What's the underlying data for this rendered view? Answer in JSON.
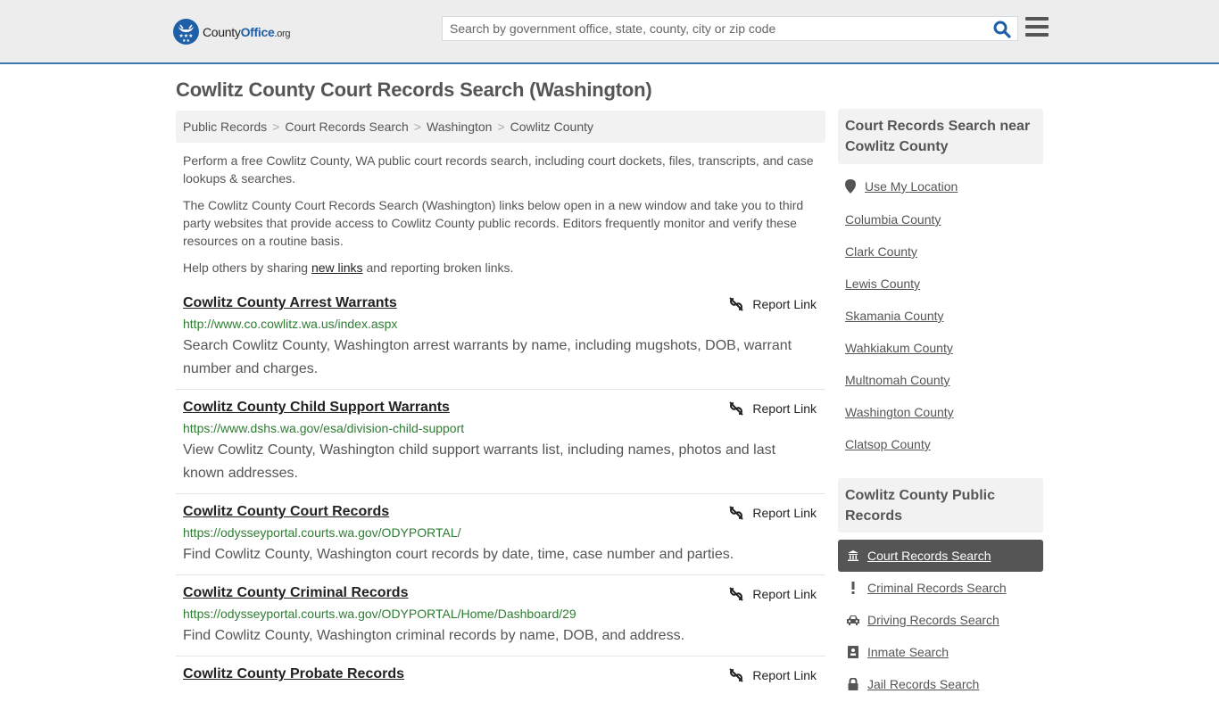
{
  "header": {
    "logo": {
      "name": "County",
      "name_accent": "Office",
      "tld": ".org"
    },
    "search": {
      "placeholder": "Search by government office, state, county, city or zip code",
      "value": ""
    },
    "icons": {
      "search": "search-icon",
      "menu": "hamburger-menu-icon"
    },
    "brand_color": "#1f5fa8",
    "border_color": "#3b78ad"
  },
  "page": {
    "title": "Cowlitz County Court Records Search (Washington)",
    "breadcrumb": [
      "Public Records",
      "Court Records Search",
      "Washington",
      "Cowlitz County"
    ],
    "intro": {
      "p1": "Perform a free Cowlitz County, WA public court records search, including court dockets, files, transcripts, and case lookups & searches.",
      "p2": "The Cowlitz County Court Records Search (Washington) links below open in a new window and take you to third party websites that provide access to Cowlitz County public records. Editors frequently monitor and verify these resources on a routine basis.",
      "p3_before": "Help others by sharing ",
      "p3_link": "new links",
      "p3_after": " and reporting broken links."
    }
  },
  "results": [
    {
      "title": "Cowlitz County Arrest Warrants",
      "url": "http://www.co.cowlitz.wa.us/index.aspx",
      "description": "Search Cowlitz County, Washington arrest warrants by name, including mugshots, DOB, warrant number and charges.",
      "report_label": "Report Link"
    },
    {
      "title": "Cowlitz County Child Support Warrants",
      "url": "https://www.dshs.wa.gov/esa/division-child-support",
      "description": "View Cowlitz County, Washington child support warrants list, including names, photos and last known addresses.",
      "report_label": "Report Link"
    },
    {
      "title": "Cowlitz County Court Records",
      "url": "https://odysseyportal.courts.wa.gov/ODYPORTAL/",
      "description": "Find Cowlitz County, Washington court records by date, time, case number and parties.",
      "report_label": "Report Link"
    },
    {
      "title": "Cowlitz County Criminal Records",
      "url": "https://odysseyportal.courts.wa.gov/ODYPORTAL/Home/Dashboard/29",
      "description": "Find Cowlitz County, Washington criminal records by name, DOB, and address.",
      "report_label": "Report Link"
    },
    {
      "title": "Cowlitz County Probate Records",
      "url": "",
      "description": "",
      "report_label": "Report Link"
    }
  ],
  "sidebar": {
    "nearby": {
      "heading": "Court Records Search near Cowlitz County",
      "use_location": "Use My Location",
      "counties": [
        "Columbia County",
        "Clark County",
        "Lewis County",
        "Skamania County",
        "Wahkiakum County",
        "Multnomah County",
        "Washington County",
        "Clatsop County"
      ]
    },
    "public_records": {
      "heading": "Cowlitz County Public Records",
      "items": [
        {
          "label": "Court Records Search",
          "icon": "courthouse-icon",
          "active": true
        },
        {
          "label": "Criminal Records Search",
          "icon": "exclamation-icon",
          "active": false
        },
        {
          "label": "Driving Records Search",
          "icon": "car-icon",
          "active": false
        },
        {
          "label": "Inmate Search",
          "icon": "id-badge-icon",
          "active": false
        },
        {
          "label": "Jail Records Search",
          "icon": "lock-icon",
          "active": false
        }
      ]
    }
  }
}
